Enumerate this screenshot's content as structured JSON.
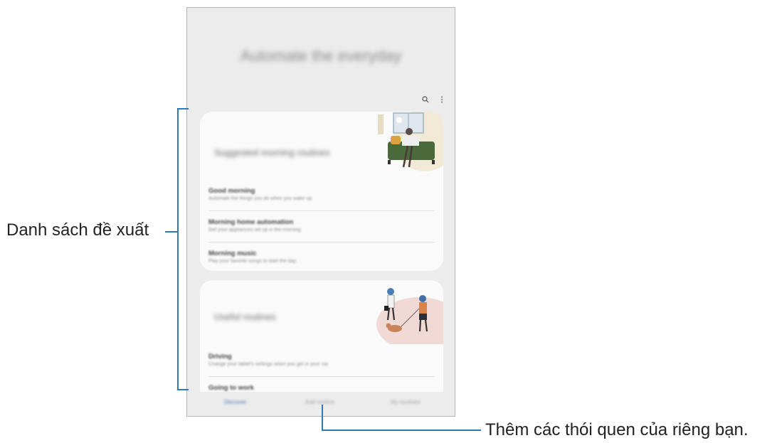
{
  "app": {
    "hero_title": "Automate the everyday",
    "top_icons": [
      "search-icon",
      "more-vert-icon"
    ]
  },
  "cards": [
    {
      "title": "Suggested morning routines",
      "items": [
        {
          "title": "Good morning",
          "subtitle": "Automate the things you do when you wake up."
        },
        {
          "title": "Morning home automation",
          "subtitle": "Get your appliances set up in the morning."
        },
        {
          "title": "Morning music",
          "subtitle": "Play your favorite songs to start the day."
        }
      ]
    },
    {
      "title": "Useful routines",
      "items": [
        {
          "title": "Driving",
          "subtitle": "Change your tablet's settings when you get in your car."
        },
        {
          "title": "Going to work",
          "subtitle": ""
        }
      ]
    }
  ],
  "tabs": [
    {
      "label": "Discover",
      "active": true
    },
    {
      "label": "Add routine",
      "active": false
    },
    {
      "label": "My routines",
      "active": false
    }
  ],
  "annotations": {
    "suggested_list": "Danh sách đề xuất",
    "add_own_routines": "Thêm các thói quen của riêng bạn."
  },
  "colors": {
    "callout_line": "#2e7ab8",
    "active_tab": "#4a78b8",
    "device_bg": "#ececec",
    "card_bg": "#fafafa"
  }
}
